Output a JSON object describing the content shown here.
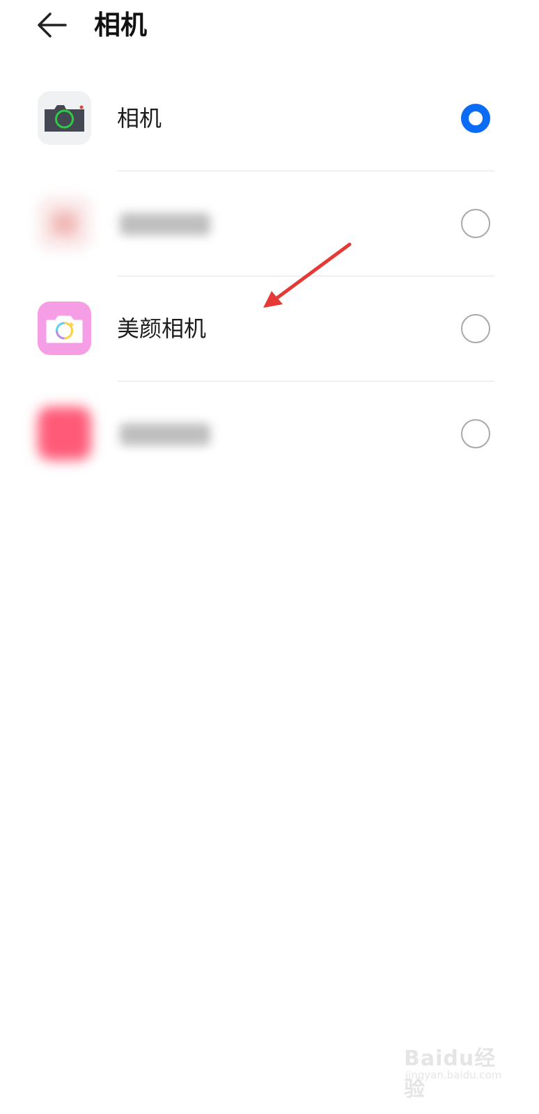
{
  "header": {
    "back_icon": "arrow-left-icon",
    "title": "相机"
  },
  "apps": [
    {
      "label": "相机",
      "icon": "camera-app-icon",
      "selected": true,
      "blurred": false
    },
    {
      "label": "",
      "icon": "blurred-app-icon",
      "selected": false,
      "blurred": true
    },
    {
      "label": "美颜相机",
      "icon": "beauty-camera-app-icon",
      "selected": false,
      "blurred": false
    },
    {
      "label": "",
      "icon": "blurred-app-icon",
      "selected": false,
      "blurred": true
    }
  ],
  "colors": {
    "accent": "#0a6cf5",
    "annotation_arrow": "#e53935",
    "beauty_cam_bg": "#f59ee6"
  },
  "watermark": {
    "line1": "Baidu经验",
    "line2": "jingyan.baidu.com"
  }
}
